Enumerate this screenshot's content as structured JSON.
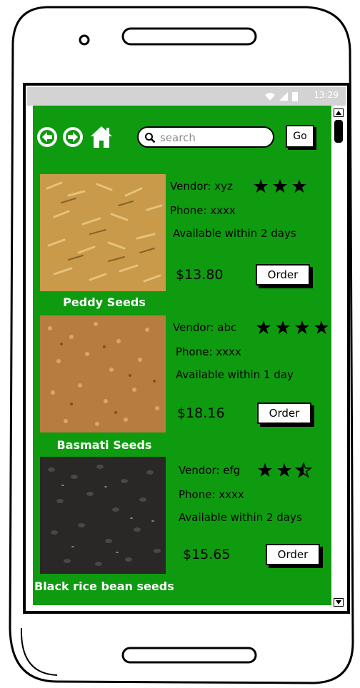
{
  "status_bar": {
    "time": "13:29"
  },
  "toolbar": {
    "back_icon": "arrow-left-circle-icon",
    "forward_icon": "arrow-right-circle-icon",
    "home_icon": "home-icon",
    "search_placeholder": "search",
    "search_value": "",
    "go_label": "Go"
  },
  "products": [
    {
      "name": "Peddy Seeds",
      "vendor": "Vendor: xyz",
      "rating": 3,
      "phone": "Phone: xxxx",
      "availability": "Available within 2 days",
      "price": "$13.80",
      "order_label": "Order",
      "image_color": "#c89a4a"
    },
    {
      "name": "Basmati Seeds",
      "vendor": "Vendor: abc",
      "rating": 4,
      "phone": "Phone: xxxx",
      "availability": "Available within 1 day",
      "price": "$18.16",
      "order_label": "Order",
      "image_color": "#b77d3f"
    },
    {
      "name": "Black rice bean seeds",
      "vendor": "Vendor: efg",
      "rating": 2.5,
      "phone": "Phone: xxxx",
      "availability": "Available within 2 days",
      "price": "$15.65",
      "order_label": "Order",
      "image_color": "#2a2727"
    }
  ],
  "colors": {
    "content_bg": "#0f9b0f",
    "status_bg": "#d3d3d3",
    "text_on_green": "#ffffff",
    "button_bg": "#ffffff"
  }
}
